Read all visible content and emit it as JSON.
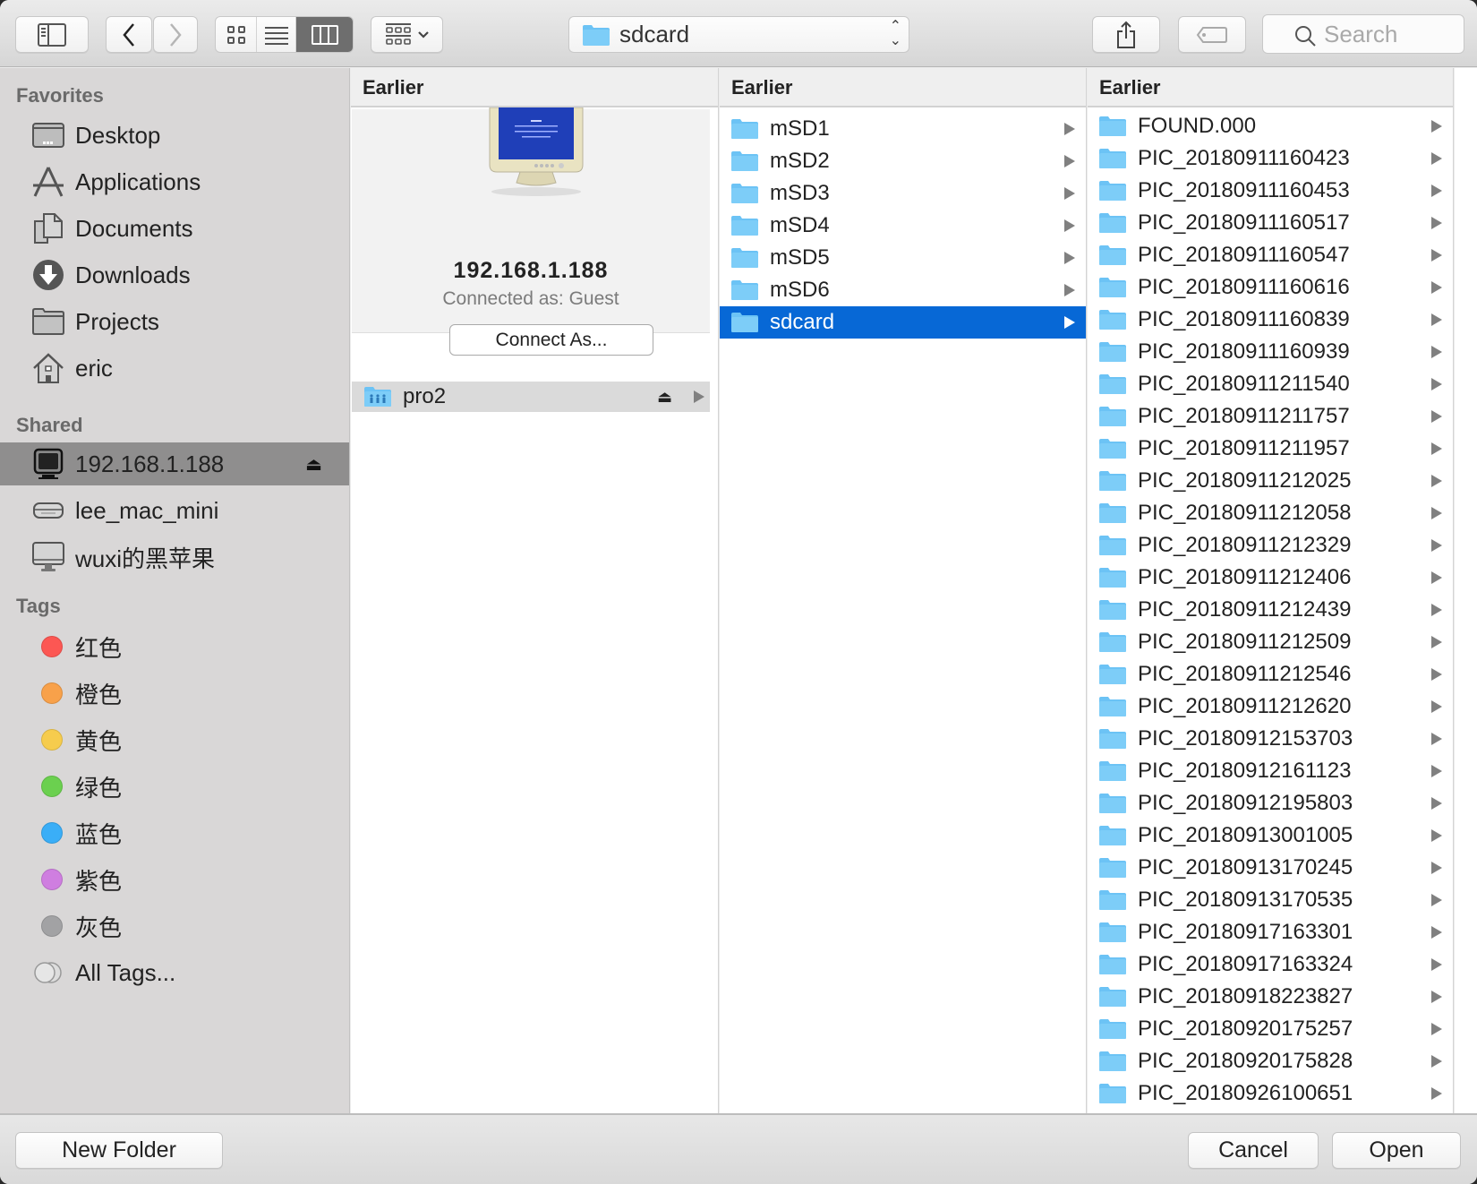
{
  "toolbar": {
    "path_current": "sdcard",
    "search_placeholder": "Search",
    "view_modes": [
      "icon",
      "list",
      "column"
    ],
    "active_view": "column"
  },
  "sidebar": {
    "favorites_label": "Favorites",
    "favorites": [
      {
        "label": "Desktop",
        "icon": "desktop-icon"
      },
      {
        "label": "Applications",
        "icon": "applications-icon"
      },
      {
        "label": "Documents",
        "icon": "documents-icon"
      },
      {
        "label": "Downloads",
        "icon": "downloads-icon"
      },
      {
        "label": "Projects",
        "icon": "folder-icon"
      },
      {
        "label": "eric",
        "icon": "home-icon"
      }
    ],
    "shared_label": "Shared",
    "shared": [
      {
        "label": "192.168.1.188",
        "icon": "monitor-icon",
        "selected": true,
        "eject": "⏏"
      },
      {
        "label": "lee_mac_mini",
        "icon": "mac-mini-icon"
      },
      {
        "label": "wuxi的黑苹果",
        "icon": "imac-icon"
      }
    ],
    "tags_label": "Tags",
    "tags": [
      {
        "label": "红色",
        "color": "#fc5753"
      },
      {
        "label": "橙色",
        "color": "#f8a14a"
      },
      {
        "label": "黄色",
        "color": "#f6cc4d"
      },
      {
        "label": "绿色",
        "color": "#6bd04f"
      },
      {
        "label": "蓝色",
        "color": "#3aaef7"
      },
      {
        "label": "紫色",
        "color": "#cf7ee0"
      },
      {
        "label": "灰色",
        "color": "#a2a2a4"
      }
    ],
    "all_tags_label": "All Tags..."
  },
  "columns": [
    {
      "header": "Earlier",
      "server": {
        "name": "192.168.1.188",
        "status": "Connected as: Guest",
        "connect_button": "Connect As..."
      },
      "shares": [
        {
          "label": "pro2",
          "eject": "⏏"
        }
      ]
    },
    {
      "header": "Earlier",
      "items": [
        "mSD1",
        "mSD2",
        "mSD3",
        "mSD4",
        "mSD5",
        "mSD6",
        "sdcard"
      ],
      "selected": "sdcard"
    },
    {
      "header": "Earlier",
      "items": [
        "FOUND.000",
        "PIC_20180911160423",
        "PIC_20180911160453",
        "PIC_20180911160517",
        "PIC_20180911160547",
        "PIC_20180911160616",
        "PIC_20180911160839",
        "PIC_20180911160939",
        "PIC_20180911211540",
        "PIC_20180911211757",
        "PIC_20180911211957",
        "PIC_20180911212025",
        "PIC_20180911212058",
        "PIC_20180911212329",
        "PIC_20180911212406",
        "PIC_20180911212439",
        "PIC_20180911212509",
        "PIC_20180911212546",
        "PIC_20180911212620",
        "PIC_20180912153703",
        "PIC_20180912161123",
        "PIC_20180912195803",
        "PIC_20180913001005",
        "PIC_20180913170245",
        "PIC_20180913170535",
        "PIC_20180917163301",
        "PIC_20180917163324",
        "PIC_20180918223827",
        "PIC_20180920175257",
        "PIC_20180920175828",
        "PIC_20180926100651"
      ]
    }
  ],
  "footer": {
    "new_folder": "New Folder",
    "cancel": "Cancel",
    "open": "Open"
  },
  "colors": {
    "selection": "#0768d6",
    "folder": "#6cc3f5",
    "sidebar_selected": "#8f8e8e"
  }
}
